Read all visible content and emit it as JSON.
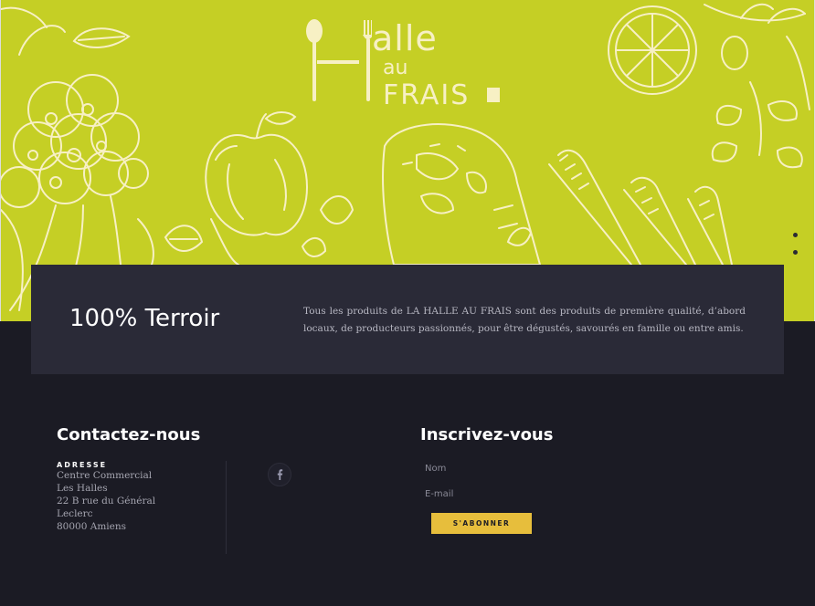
{
  "brand": {
    "logo_line1": "alle",
    "logo_line2": "au",
    "logo_line3": "FRAIS"
  },
  "colors": {
    "hero_green": "#c5cf25",
    "sketch_cream": "#f7f0c4",
    "band_bg": "#2a2a37",
    "footer_bg": "#1b1b24",
    "accent_yellow": "#e7be3c"
  },
  "highlight": {
    "title": "100% Terroir",
    "text": "Tous les produits de LA HALLE AU FRAIS sont des produits de première qualité, d’abord locaux, de producteurs passionnés, pour être dégustés, savourés en famille ou entre amis."
  },
  "contact": {
    "title": "Contactez-nous",
    "address_label": "ADRESSE",
    "address_lines": [
      "Centre Commercial",
      "Les Halles",
      "22 B rue du Général",
      "Leclerc",
      "80000 Amiens"
    ],
    "social_icon": "facebook-icon"
  },
  "newsletter": {
    "title": "Inscrivez-vous",
    "name_placeholder": "Nom",
    "email_placeholder": "E-mail",
    "submit_label": "S'ABONNER"
  }
}
